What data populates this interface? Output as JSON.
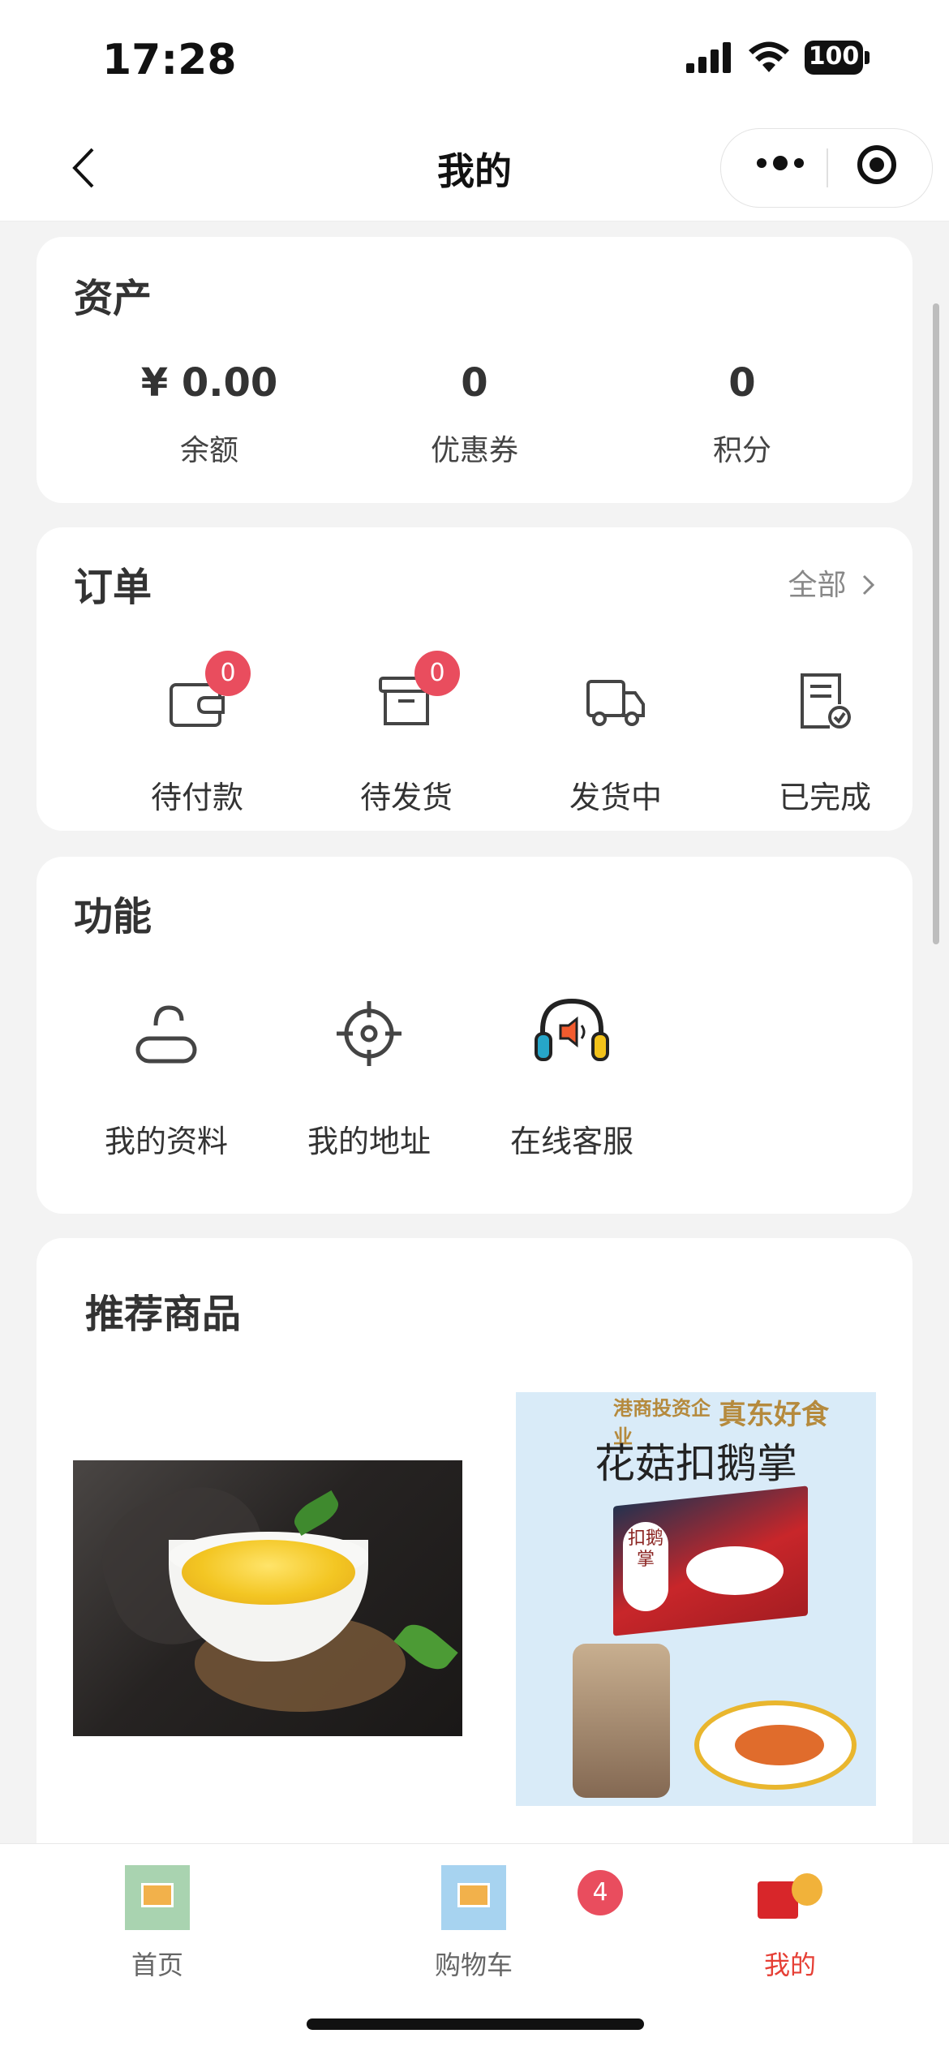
{
  "status_bar": {
    "time": "17:28",
    "battery": "100"
  },
  "nav": {
    "title": "我的"
  },
  "assets": {
    "title": "资产",
    "items": [
      {
        "value": "¥ 0.00",
        "label": "余额"
      },
      {
        "value": "0",
        "label": "优惠券"
      },
      {
        "value": "0",
        "label": "积分"
      }
    ]
  },
  "orders": {
    "title": "订单",
    "all_label": "全部",
    "items": [
      {
        "label": "待付款",
        "badge": "0",
        "icon": "wallet-icon"
      },
      {
        "label": "待发货",
        "badge": "0",
        "icon": "box-icon"
      },
      {
        "label": "发货中",
        "icon": "truck-icon"
      },
      {
        "label": "已完成",
        "icon": "checklist-icon"
      }
    ]
  },
  "functions": {
    "title": "功能",
    "items": [
      {
        "label": "我的资料",
        "icon": "user-profile-icon"
      },
      {
        "label": "我的地址",
        "icon": "location-target-icon"
      },
      {
        "label": "在线客服",
        "icon": "headset-icon"
      }
    ]
  },
  "recommend": {
    "title": "推荐商品",
    "product2_headline": "花菇扣鹅掌",
    "product2_brand": "真东好食",
    "product2_tagline": "港商投资企业",
    "product2_box_label": "扣鹅掌"
  },
  "tabbar": {
    "items": [
      {
        "label": "首页",
        "active": false
      },
      {
        "label": "购物车",
        "active": false,
        "badge": "4"
      },
      {
        "label": "我的",
        "active": true
      }
    ]
  },
  "colors": {
    "accent": "#e63f35",
    "badge": "#e94d5e",
    "background": "#f3f3f3"
  }
}
